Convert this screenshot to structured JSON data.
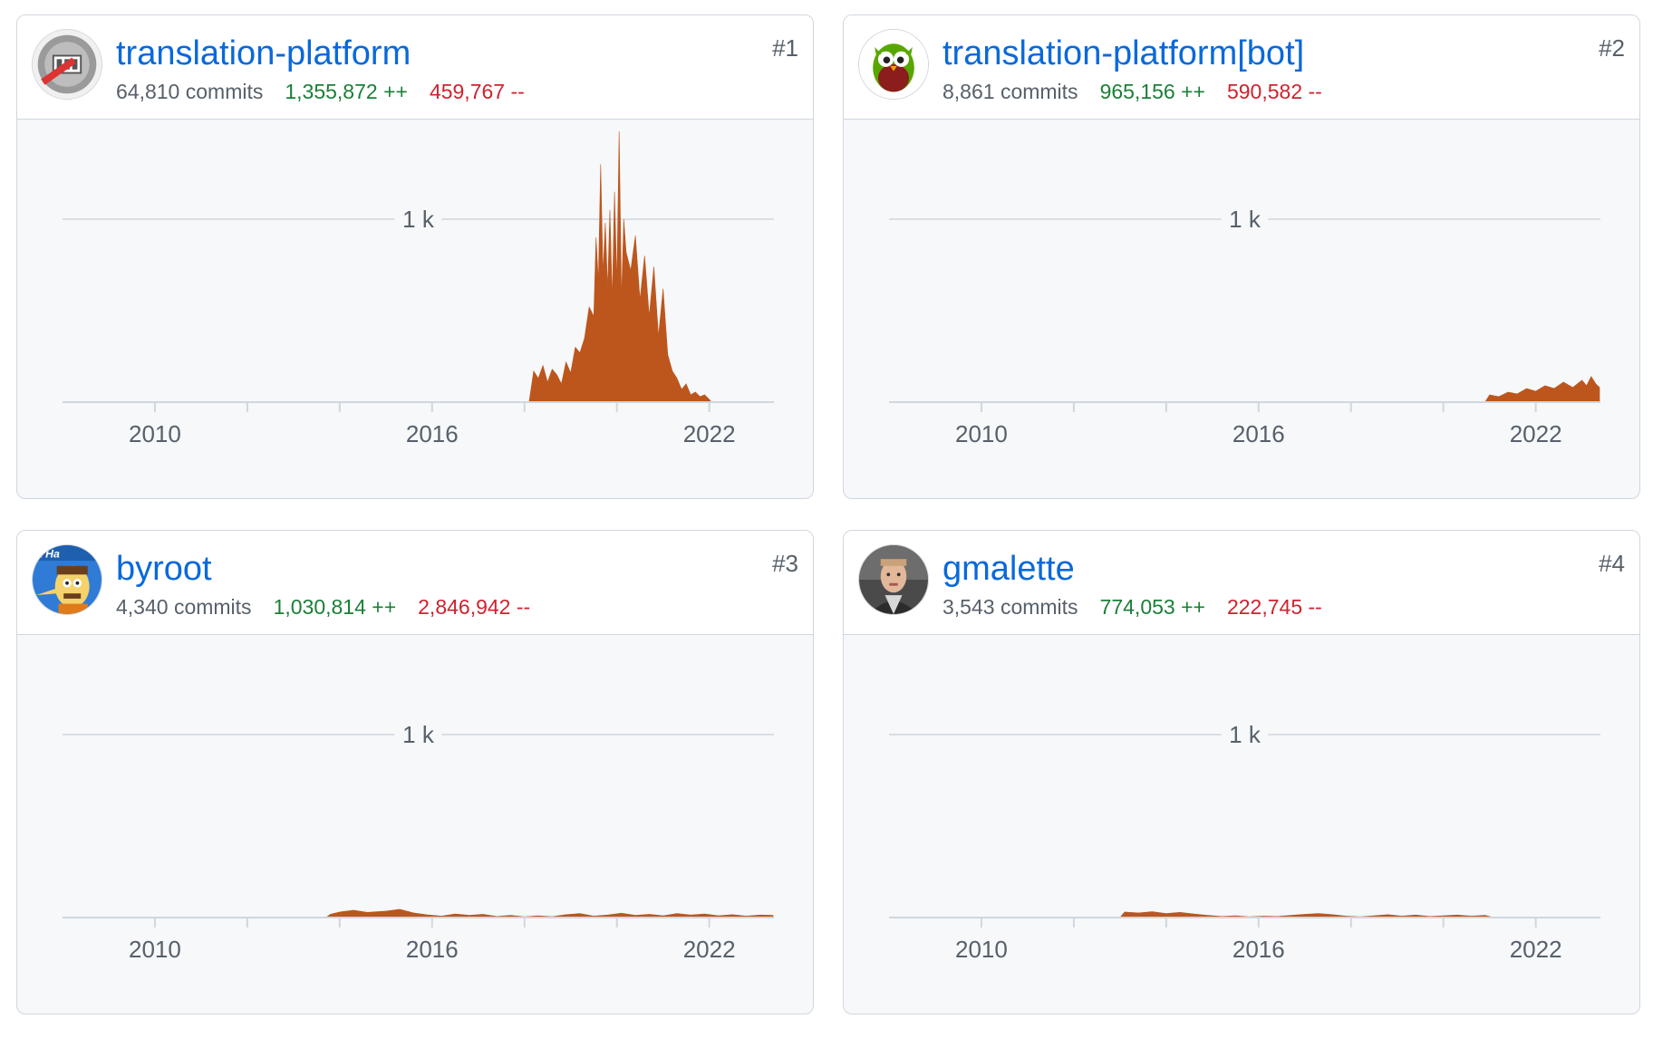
{
  "colors": {
    "link": "#0969da",
    "additions": "#1a7f37",
    "deletions": "#cf222e",
    "area": "#bd561d",
    "grid": "#d8dee4",
    "muted": "#57606a"
  },
  "contributors": [
    {
      "rank": "#1",
      "name": "translation-platform",
      "commits": "64,810 commits",
      "additions": "1,355,872 ++",
      "deletions": "459,767 --",
      "avatar_icon": "translation-platform-logo-icon"
    },
    {
      "rank": "#2",
      "name": "translation-platform[bot]",
      "commits": "8,861 commits",
      "additions": "965,156 ++",
      "deletions": "590,582 --",
      "avatar_icon": "owl-icon"
    },
    {
      "rank": "#3",
      "name": "byroot",
      "commits": "4,340 commits",
      "additions": "1,030,814 ++",
      "deletions": "2,846,942 --",
      "avatar_icon": "cartoon-avatar-icon"
    },
    {
      "rank": "#4",
      "name": "gmalette",
      "commits": "3,543 commits",
      "additions": "774,053 ++",
      "deletions": "222,745 --",
      "avatar_icon": "photo-avatar-icon"
    }
  ],
  "chart_data": [
    {
      "type": "area",
      "contributor": "translation-platform",
      "x_ticks": [
        "2010",
        "2016",
        "2022"
      ],
      "y_ticks": [
        "1 k"
      ],
      "y_tick_values": [
        1000
      ],
      "xlim": [
        2008.0,
        2023.4
      ],
      "ylim": [
        0,
        1500
      ],
      "grid": true,
      "points": [
        [
          2018.1,
          0
        ],
        [
          2018.2,
          170
        ],
        [
          2018.3,
          130
        ],
        [
          2018.4,
          200
        ],
        [
          2018.5,
          110
        ],
        [
          2018.6,
          180
        ],
        [
          2018.7,
          150
        ],
        [
          2018.8,
          100
        ],
        [
          2018.9,
          220
        ],
        [
          2019.0,
          160
        ],
        [
          2019.1,
          300
        ],
        [
          2019.2,
          270
        ],
        [
          2019.3,
          350
        ],
        [
          2019.4,
          520
        ],
        [
          2019.5,
          470
        ],
        [
          2019.55,
          900
        ],
        [
          2019.6,
          660
        ],
        [
          2019.65,
          1300
        ],
        [
          2019.7,
          700
        ],
        [
          2019.75,
          980
        ],
        [
          2019.8,
          620
        ],
        [
          2019.85,
          1050
        ],
        [
          2019.9,
          560
        ],
        [
          2019.95,
          1150
        ],
        [
          2020.0,
          650
        ],
        [
          2020.05,
          1480
        ],
        [
          2020.1,
          560
        ],
        [
          2020.15,
          1000
        ],
        [
          2020.2,
          820
        ],
        [
          2020.3,
          720
        ],
        [
          2020.4,
          910
        ],
        [
          2020.5,
          560
        ],
        [
          2020.6,
          800
        ],
        [
          2020.7,
          470
        ],
        [
          2020.8,
          740
        ],
        [
          2020.9,
          360
        ],
        [
          2021.0,
          620
        ],
        [
          2021.1,
          260
        ],
        [
          2021.2,
          170
        ],
        [
          2021.3,
          130
        ],
        [
          2021.4,
          70
        ],
        [
          2021.5,
          100
        ],
        [
          2021.6,
          40
        ],
        [
          2021.7,
          55
        ],
        [
          2021.8,
          30
        ],
        [
          2021.9,
          40
        ],
        [
          2022.0,
          15
        ],
        [
          2022.05,
          0
        ]
      ]
    },
    {
      "type": "area",
      "contributor": "translation-platform[bot]",
      "x_ticks": [
        "2010",
        "2016",
        "2022"
      ],
      "y_ticks": [
        "1 k"
      ],
      "y_tick_values": [
        1000
      ],
      "xlim": [
        2008.0,
        2023.4
      ],
      "ylim": [
        0,
        1500
      ],
      "grid": true,
      "points": [
        [
          2020.9,
          0
        ],
        [
          2021.0,
          40
        ],
        [
          2021.2,
          30
        ],
        [
          2021.4,
          55
        ],
        [
          2021.6,
          45
        ],
        [
          2021.8,
          75
        ],
        [
          2022.0,
          60
        ],
        [
          2022.2,
          90
        ],
        [
          2022.4,
          75
        ],
        [
          2022.6,
          110
        ],
        [
          2022.8,
          80
        ],
        [
          2023.0,
          120
        ],
        [
          2023.1,
          90
        ],
        [
          2023.2,
          140
        ],
        [
          2023.3,
          100
        ],
        [
          2023.38,
          80
        ],
        [
          2023.38,
          0
        ]
      ]
    },
    {
      "type": "area",
      "contributor": "byroot",
      "x_ticks": [
        "2010",
        "2016",
        "2022"
      ],
      "y_ticks": [
        "1 k"
      ],
      "y_tick_values": [
        1000
      ],
      "xlim": [
        2008.0,
        2023.4
      ],
      "ylim": [
        0,
        1500
      ],
      "grid": true,
      "points": [
        [
          2013.7,
          0
        ],
        [
          2013.8,
          18
        ],
        [
          2014.0,
          30
        ],
        [
          2014.3,
          40
        ],
        [
          2014.6,
          28
        ],
        [
          2015.0,
          35
        ],
        [
          2015.3,
          45
        ],
        [
          2015.6,
          25
        ],
        [
          2015.9,
          15
        ],
        [
          2016.2,
          8
        ],
        [
          2016.5,
          20
        ],
        [
          2016.8,
          12
        ],
        [
          2017.1,
          18
        ],
        [
          2017.4,
          6
        ],
        [
          2017.7,
          12
        ],
        [
          2018.0,
          4
        ],
        [
          2018.3,
          10
        ],
        [
          2018.6,
          5
        ],
        [
          2018.9,
          16
        ],
        [
          2019.2,
          22
        ],
        [
          2019.5,
          8
        ],
        [
          2019.8,
          14
        ],
        [
          2020.1,
          24
        ],
        [
          2020.4,
          12
        ],
        [
          2020.7,
          18
        ],
        [
          2021.0,
          10
        ],
        [
          2021.3,
          22
        ],
        [
          2021.6,
          14
        ],
        [
          2021.9,
          20
        ],
        [
          2022.2,
          10
        ],
        [
          2022.5,
          16
        ],
        [
          2022.8,
          8
        ],
        [
          2023.1,
          14
        ],
        [
          2023.38,
          12
        ],
        [
          2023.38,
          0
        ]
      ]
    },
    {
      "type": "area",
      "contributor": "gmalette",
      "x_ticks": [
        "2010",
        "2016",
        "2022"
      ],
      "y_ticks": [
        "1 k"
      ],
      "y_tick_values": [
        1000
      ],
      "xlim": [
        2008.0,
        2023.4
      ],
      "ylim": [
        0,
        1500
      ],
      "grid": true,
      "points": [
        [
          2013.0,
          0
        ],
        [
          2013.1,
          30
        ],
        [
          2013.4,
          25
        ],
        [
          2013.7,
          32
        ],
        [
          2014.0,
          22
        ],
        [
          2014.3,
          28
        ],
        [
          2014.6,
          20
        ],
        [
          2014.9,
          12
        ],
        [
          2015.2,
          6
        ],
        [
          2015.5,
          10
        ],
        [
          2015.8,
          4
        ],
        [
          2016.1,
          8
        ],
        [
          2016.4,
          6
        ],
        [
          2016.7,
          12
        ],
        [
          2017.0,
          18
        ],
        [
          2017.3,
          22
        ],
        [
          2017.6,
          16
        ],
        [
          2017.9,
          8
        ],
        [
          2018.2,
          4
        ],
        [
          2018.5,
          10
        ],
        [
          2018.8,
          16
        ],
        [
          2019.1,
          8
        ],
        [
          2019.4,
          14
        ],
        [
          2019.7,
          6
        ],
        [
          2020.0,
          10
        ],
        [
          2020.3,
          14
        ],
        [
          2020.6,
          8
        ],
        [
          2020.9,
          12
        ],
        [
          2021.1,
          0
        ]
      ]
    }
  ]
}
